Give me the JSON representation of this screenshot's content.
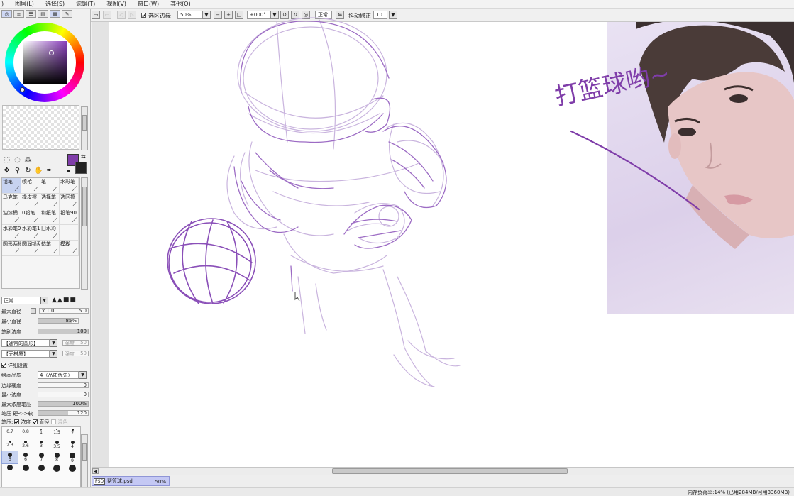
{
  "menu": {
    "items": [
      "图层(L)",
      "选择(S)",
      "滤镜(T)",
      "视图(V)",
      "窗口(W)",
      "其他(O)"
    ]
  },
  "toolbar": {
    "selection_edge_label": "选区边缘",
    "selection_edge_checked": true,
    "zoom_value": "50%",
    "rotation_value": "+000°",
    "blend_mode": "正常",
    "stabilizer_label": "抖动修正",
    "stabilizer_value": "10"
  },
  "tools": {
    "foreground_color": "#7f3da9",
    "background_color": "#222222"
  },
  "brushes": {
    "items": [
      {
        "label": "铅笔",
        "icon": "pencil-icon",
        "selected": true
      },
      {
        "label": "喷枪",
        "icon": "airbrush-icon",
        "selected": false
      },
      {
        "label": "笔",
        "icon": "pen-icon",
        "selected": false
      },
      {
        "label": "水彩笔",
        "icon": "watercolor-icon",
        "selected": false
      },
      {
        "label": "马克笔",
        "icon": "marker-icon",
        "selected": false
      },
      {
        "label": "橡皮擦",
        "icon": "eraser-icon",
        "selected": false
      },
      {
        "label": "选择笔",
        "icon": "select-pen-icon",
        "selected": false
      },
      {
        "label": "选区擦",
        "icon": "select-eraser-icon",
        "selected": false
      },
      {
        "label": "油漆桶",
        "icon": "bucket-icon",
        "selected": false
      },
      {
        "label": "0铅笔",
        "icon": "pencil-icon",
        "selected": false
      },
      {
        "label": "和纸笔",
        "icon": "paper-brush-icon",
        "selected": false
      },
      {
        "label": "铅笔90",
        "icon": "pencil-icon",
        "selected": false
      },
      {
        "label": "水彩笔9的",
        "icon": "watercolor-icon",
        "selected": false
      },
      {
        "label": "水彩笔10的",
        "icon": "watercolor-icon",
        "selected": false
      },
      {
        "label": "旧水彩",
        "icon": "watercolor-icon",
        "selected": false
      },
      {
        "label": "",
        "icon": "",
        "selected": false
      },
      {
        "label": "圆形两棒",
        "icon": "brush-icon",
        "selected": false
      },
      {
        "label": "圆润铅两棒",
        "icon": "brush-icon",
        "selected": false
      },
      {
        "label": "蜡笔",
        "icon": "crayon-icon",
        "selected": false
      },
      {
        "label": "模糊",
        "icon": "blur-icon",
        "selected": false
      }
    ]
  },
  "brush_settings": {
    "mode": "正常",
    "max_diameter_label": "最大直径",
    "max_diameter_mult": "x 1.0",
    "max_diameter_value": "5.0",
    "min_diameter_label": "最小直径",
    "min_diameter_value": "85%",
    "min_diameter_fraction": 0.85,
    "density_label": "笔刷浓度",
    "density_value": "100",
    "density_fraction": 1.0,
    "shape_combo": "【通常的圆形】",
    "shape_strength_label": "强度",
    "shape_strength_value": "50",
    "texture_combo": "【无材质】",
    "texture_strength_label": "强度",
    "texture_strength_value": "50",
    "detail_label": "详细设置",
    "detail_checked": true,
    "quality_label": "绘画品质",
    "quality_value": "4（品质优先）",
    "edge_hardness_label": "边缘硬度",
    "edge_hardness_value": "0",
    "min_density_label": "最小浓度",
    "min_density_value": "0",
    "max_density_pressure_label": "最大浓度笔压",
    "max_density_pressure_value": "100%",
    "max_density_pressure_fraction": 1.0,
    "pressure_hardness_label": "笔压 硬<->软",
    "pressure_hardness_value": "120",
    "pressure_hardness_fraction": 0.6,
    "pressure_label": "笔压:",
    "pressure_density_label": "浓度",
    "pressure_density_checked": true,
    "pressure_diameter_label": "直径",
    "pressure_diameter_checked": true,
    "pressure_blend_label": "混色",
    "pressure_blend_checked": false
  },
  "brush_sizes": [
    {
      "label": "0.7",
      "selected": false
    },
    {
      "label": "0.8",
      "selected": false
    },
    {
      "label": "1",
      "selected": false
    },
    {
      "label": "1.5",
      "selected": false
    },
    {
      "label": "2",
      "selected": false
    },
    {
      "label": "2.3",
      "selected": false
    },
    {
      "label": "2.6",
      "selected": false
    },
    {
      "label": "3",
      "selected": false
    },
    {
      "label": "3.5",
      "selected": false
    },
    {
      "label": "4",
      "selected": false
    },
    {
      "label": "5",
      "selected": true
    },
    {
      "label": "6",
      "selected": false
    },
    {
      "label": "7",
      "selected": false
    },
    {
      "label": "8",
      "selected": false
    },
    {
      "label": "9",
      "selected": false
    },
    {
      "label": "",
      "selected": false
    },
    {
      "label": "",
      "selected": false
    },
    {
      "label": "",
      "selected": false
    },
    {
      "label": "",
      "selected": false
    },
    {
      "label": "",
      "selected": false
    }
  ],
  "canvas": {
    "annotation_text": "打篮球哟∼",
    "ink_color": "#7f3da9"
  },
  "filetab": {
    "name": "帮篮球.psd",
    "zoom": "50%"
  },
  "status": {
    "text": "内存负荷率:14% (已用284MB/可用3360MB)"
  }
}
